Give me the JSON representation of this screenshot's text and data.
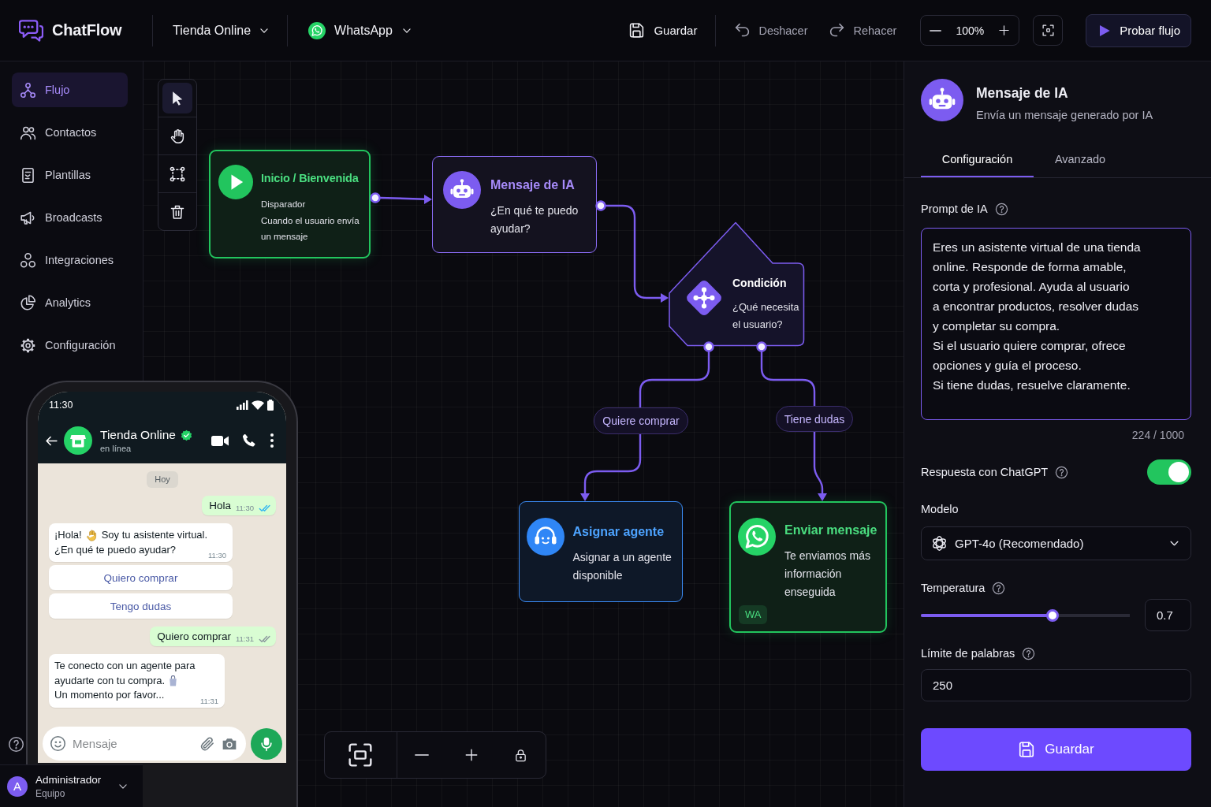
{
  "app": {
    "name": "ChatFlow"
  },
  "topbar": {
    "project": "Tienda Online",
    "channel": "WhatsApp",
    "actions": [
      {
        "kind": "save",
        "label": "Guardar",
        "disabled": false
      },
      {
        "kind": "undo",
        "label": "Deshacer",
        "disabled": true
      },
      {
        "kind": "redo",
        "label": "Rehacer",
        "disabled": true
      }
    ],
    "zoom": "100%",
    "run_button": "Probar flujo"
  },
  "sidebar": {
    "items": [
      {
        "kind": "flow",
        "label": "Flujo",
        "selected": true
      },
      {
        "kind": "contacts",
        "label": "Contactos",
        "selected": false
      },
      {
        "kind": "templates",
        "label": "Plantillas",
        "selected": false
      },
      {
        "kind": "broadcasts",
        "label": "Broadcasts",
        "selected": false
      },
      {
        "kind": "integrations",
        "label": "Integraciones",
        "selected": false
      },
      {
        "kind": "analytics",
        "label": "Analytics",
        "selected": false
      },
      {
        "kind": "settings",
        "label": "Configuración",
        "selected": false
      }
    ],
    "user": {
      "initial": "A",
      "name": "Administrador",
      "role": "Equipo"
    }
  },
  "canvas": {
    "tools": [
      {
        "kind": "pointer",
        "selected": true
      },
      {
        "kind": "hand",
        "selected": false
      },
      {
        "kind": "select",
        "selected": false
      },
      {
        "kind": "delete",
        "selected": false
      }
    ],
    "nodes": [
      {
        "kind": "start",
        "title": "Inicio / Bienvenida",
        "subtitle": "Disparador",
        "text": "Cuando el usuario envía un mensaje"
      },
      {
        "kind": "ai",
        "title": "Mensaje de IA",
        "text": "¿En qué te puedo ayudar?"
      },
      {
        "kind": "condition",
        "title": "Condición",
        "text": "¿Qué necesita el usuario?"
      },
      {
        "kind": "agent",
        "title": "Asignar agente",
        "text": "Asignar a un agente disponible"
      },
      {
        "kind": "send",
        "title": "Enviar mensaje",
        "text": "Te enviamos más información enseguida",
        "badge": "WA"
      }
    ],
    "branches": [
      {
        "label": "Quiere comprar"
      },
      {
        "label": "Tiene dudas"
      }
    ],
    "view_controls": [
      {
        "kind": "fit"
      },
      {
        "kind": "zoom_out"
      },
      {
        "kind": "zoom_in"
      },
      {
        "kind": "lock"
      }
    ]
  },
  "phone": {
    "time": "11:30",
    "contact": "Tienda Online",
    "verified": true,
    "status": "en línea",
    "messages": [
      {
        "kind": "date",
        "text": "Hoy"
      },
      {
        "kind": "out",
        "text": "Hola",
        "time": "11:30",
        "read": true
      },
      {
        "kind": "in",
        "lines": [
          [
            {
              "kind": "text",
              "text": "¡Hola!"
            },
            {
              "kind": "wave"
            },
            {
              "kind": "text",
              "text": "Soy tu asistente virtual."
            }
          ],
          [
            {
              "kind": "text",
              "text": "¿En qué te puedo ayudar?"
            }
          ]
        ],
        "time": "11:30"
      },
      {
        "kind": "reply",
        "text": "Quiero comprar"
      },
      {
        "kind": "reply",
        "text": "Tengo dudas"
      },
      {
        "kind": "out",
        "text": "Quiero comprar",
        "time": "11:31",
        "read": false
      },
      {
        "kind": "in",
        "lines": [
          [
            {
              "kind": "text",
              "text": "Te conecto con un agente para"
            }
          ],
          [
            {
              "kind": "text",
              "text": "ayudarte con tu compra."
            },
            {
              "kind": "bag"
            }
          ],
          [
            {
              "kind": "text",
              "text": "Un momento por favor..."
            }
          ]
        ],
        "time": "11:31"
      }
    ],
    "input": {
      "placeholder": "Mensaje"
    }
  },
  "panel": {
    "title": "Mensaje de IA",
    "subtitle": "Envía un mensaje generado por IA",
    "tabs": [
      {
        "label": "Configuración",
        "selected": true
      },
      {
        "label": "Avanzado",
        "selected": false
      }
    ],
    "prompt": {
      "label": "Prompt de IA",
      "value": "Eres un asistente virtual de una tienda\nonline. Responde de forma amable,\ncorta y profesional. Ayuda al usuario\na encontrar productos, resolver dudas\ny completar su compra.\nSi el usuario quiere comprar, ofrece\nopciones y guía el proceso.\nSi tiene dudas, resuelve claramente.",
      "counter": "224 / 1000"
    },
    "chatgpt": {
      "label": "Respuesta con ChatGPT",
      "on": true
    },
    "model": {
      "label": "Modelo",
      "value": "GPT-4o (Recomendado)"
    },
    "temperature": {
      "label": "Temperatura",
      "level": 0.63,
      "value": "0.7"
    },
    "word_limit": {
      "label": "Límite de palabras",
      "value": "250"
    },
    "save_button": "Guardar"
  }
}
